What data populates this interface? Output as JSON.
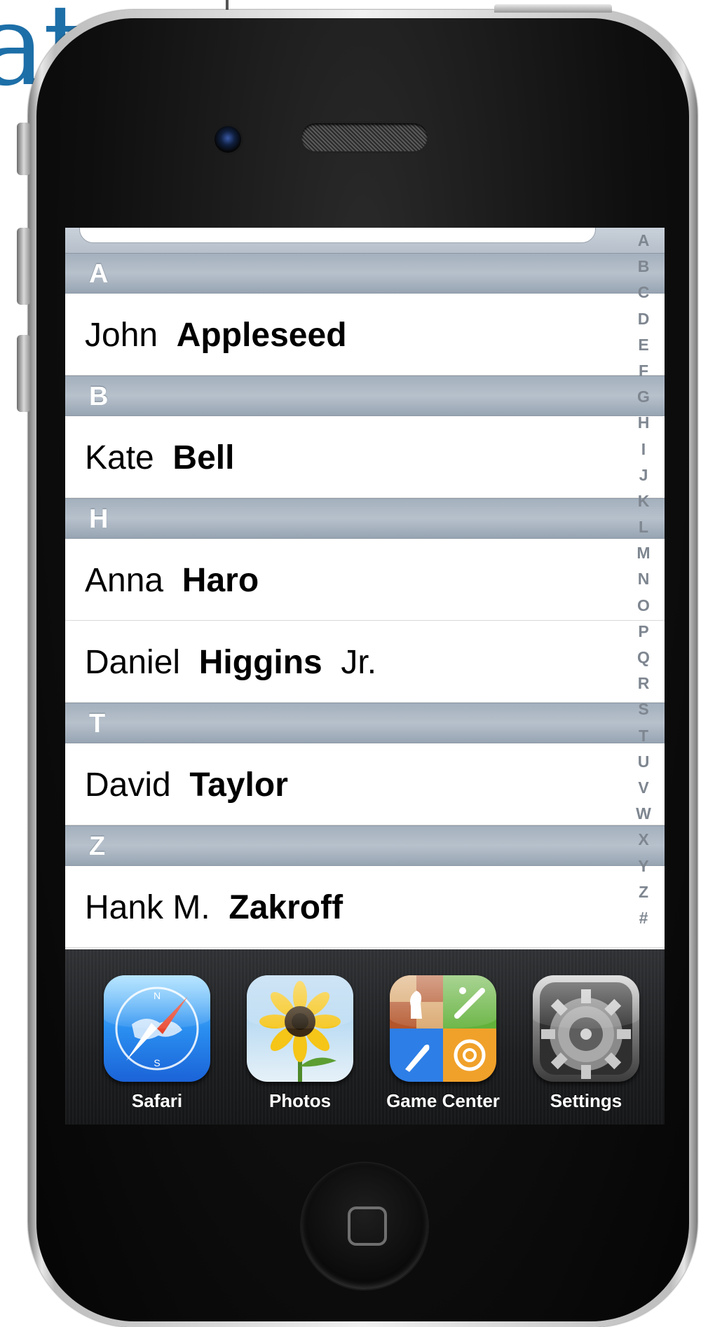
{
  "background_text": "at",
  "contacts": {
    "sections": [
      {
        "letter": "A",
        "rows": [
          {
            "first": "John",
            "last": "Appleseed",
            "suffix": ""
          }
        ]
      },
      {
        "letter": "B",
        "rows": [
          {
            "first": "Kate",
            "last": "Bell",
            "suffix": ""
          }
        ]
      },
      {
        "letter": "H",
        "rows": [
          {
            "first": "Anna",
            "last": "Haro",
            "suffix": ""
          },
          {
            "first": "Daniel",
            "last": "Higgins",
            "suffix": "Jr."
          }
        ]
      },
      {
        "letter": "T",
        "rows": [
          {
            "first": "David",
            "last": "Taylor",
            "suffix": ""
          }
        ]
      },
      {
        "letter": "Z",
        "rows": [
          {
            "first": "Hank M.",
            "last": "Zakroff",
            "suffix": ""
          }
        ]
      }
    ],
    "index": [
      "A",
      "B",
      "C",
      "D",
      "E",
      "F",
      "G",
      "H",
      "I",
      "J",
      "K",
      "L",
      "M",
      "N",
      "O",
      "P",
      "Q",
      "R",
      "S",
      "T",
      "U",
      "V",
      "W",
      "X",
      "Y",
      "Z",
      "#"
    ]
  },
  "dock": {
    "apps": [
      {
        "label": "Safari",
        "icon": "safari-icon"
      },
      {
        "label": "Photos",
        "icon": "photos-icon"
      },
      {
        "label": "Game Center",
        "icon": "game-center-icon"
      },
      {
        "label": "Settings",
        "icon": "settings-icon"
      }
    ]
  },
  "colors": {
    "section_header": "#a4b0bd",
    "index_text": "#7e8690",
    "dock": "#1c1d1f"
  }
}
